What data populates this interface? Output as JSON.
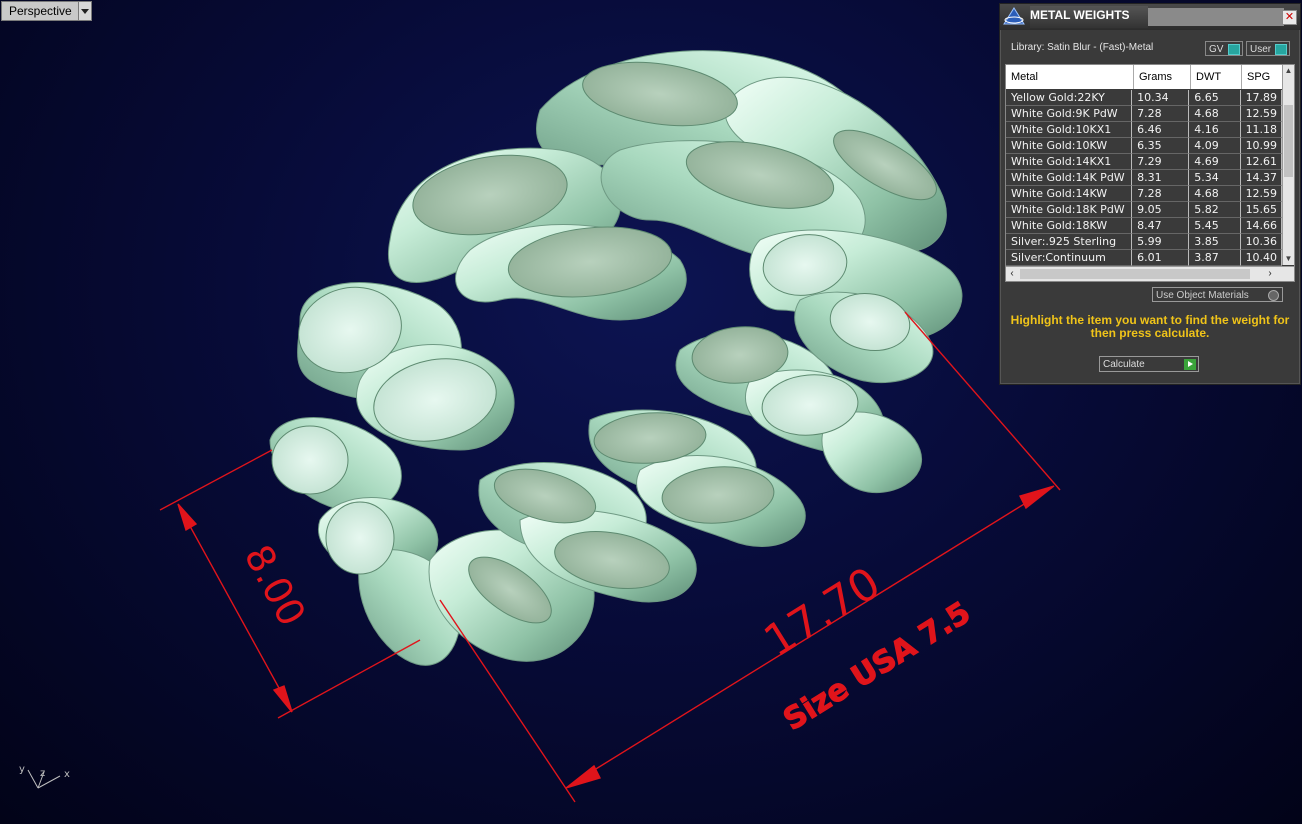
{
  "viewport": {
    "label": "Perspective",
    "axes": {
      "y": "y",
      "z": "z",
      "x": "x"
    },
    "dimensions": {
      "height": "8.00",
      "width": "17.70",
      "size_note": "Size USA 7.5"
    },
    "colors": {
      "dimension": "#e0141b",
      "background": "#070b38",
      "ring": "#b9e6cf"
    }
  },
  "panel": {
    "title": "METAL WEIGHTS",
    "close_icon": "✕",
    "library_label": "Library: Satin Blur - (Fast)-Metal",
    "gv_label": "GV",
    "user_label": "User",
    "columns": [
      "Metal",
      "Grams",
      "DWT",
      "SPG"
    ],
    "rows": [
      [
        "Yellow Gold:22KY",
        "10.34",
        "6.65",
        "17.89"
      ],
      [
        "White Gold:9K PdW",
        "7.28",
        "4.68",
        "12.59"
      ],
      [
        "White Gold:10KX1",
        "6.46",
        "4.16",
        "11.18"
      ],
      [
        "White Gold:10KW",
        "6.35",
        "4.09",
        "10.99"
      ],
      [
        "White Gold:14KX1",
        "7.29",
        "4.69",
        "12.61"
      ],
      [
        "White Gold:14K PdW",
        "8.31",
        "5.34",
        "14.37"
      ],
      [
        "White Gold:14KW",
        "7.28",
        "4.68",
        "12.59"
      ],
      [
        "White Gold:18K PdW",
        "9.05",
        "5.82",
        "15.65"
      ],
      [
        "White Gold:18KW",
        "8.47",
        "5.45",
        "14.66"
      ],
      [
        "Silver:.925 Sterling",
        "5.99",
        "3.85",
        "10.36"
      ],
      [
        "Silver:Continuum",
        "6.01",
        "3.87",
        "10.40"
      ]
    ],
    "use_object_materials": "Use Object Materials",
    "hint": "Highlight the item you want to find the weight for then press calculate.",
    "calculate_label": "Calculate"
  }
}
